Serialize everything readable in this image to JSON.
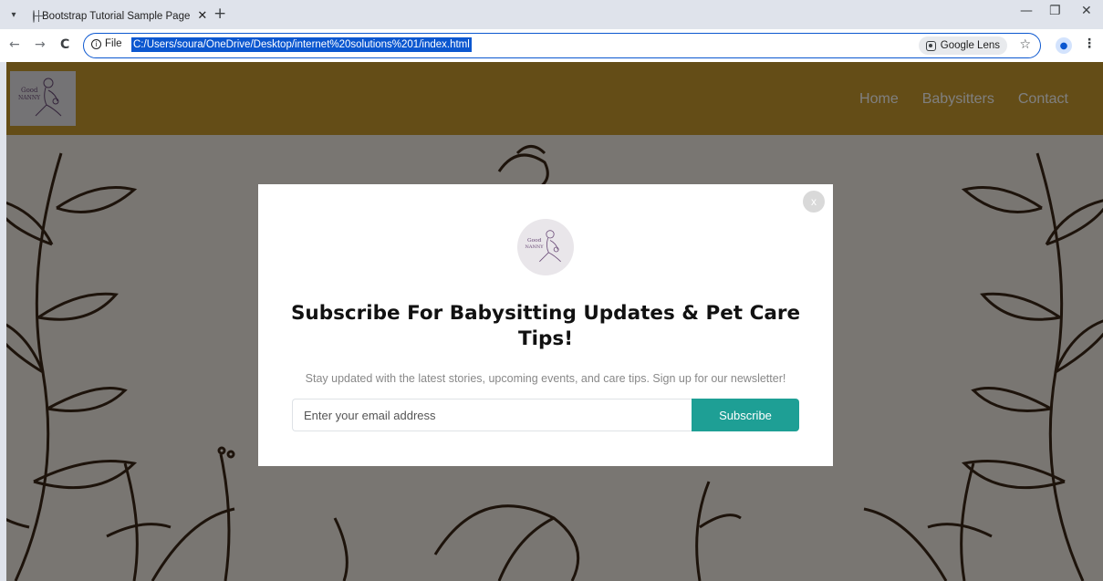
{
  "browser": {
    "tab_title": "Bootstrap Tutorial Sample Page",
    "tab_close": "✕",
    "new_tab": "+",
    "back": "←",
    "forward": "→",
    "reload": "C",
    "info_label": "File",
    "url": "C:/Users/soura/OneDrive/Desktop/internet%20solutions%201/index.html",
    "lens_label": "Google Lens",
    "star": "☆",
    "menu": "⋮",
    "minimize": "—",
    "restore": "❐",
    "close": "✕"
  },
  "navbar": {
    "bg_color": "#c99b2e",
    "links": [
      "Home",
      "Babysitters",
      "Contact"
    ]
  },
  "modal": {
    "close_label": "x",
    "title": "Subscribe For Babysitting Updates & Pet Care Tips!",
    "text": "Stay updated with the latest stories, upcoming events, and care tips. Sign up for our newsletter!",
    "email_placeholder": "Enter your email address",
    "subscribe_label": "Subscribe",
    "button_color": "#1e9f95"
  },
  "logo": {
    "text_line1": "Good",
    "text_line2": "NANNY"
  }
}
